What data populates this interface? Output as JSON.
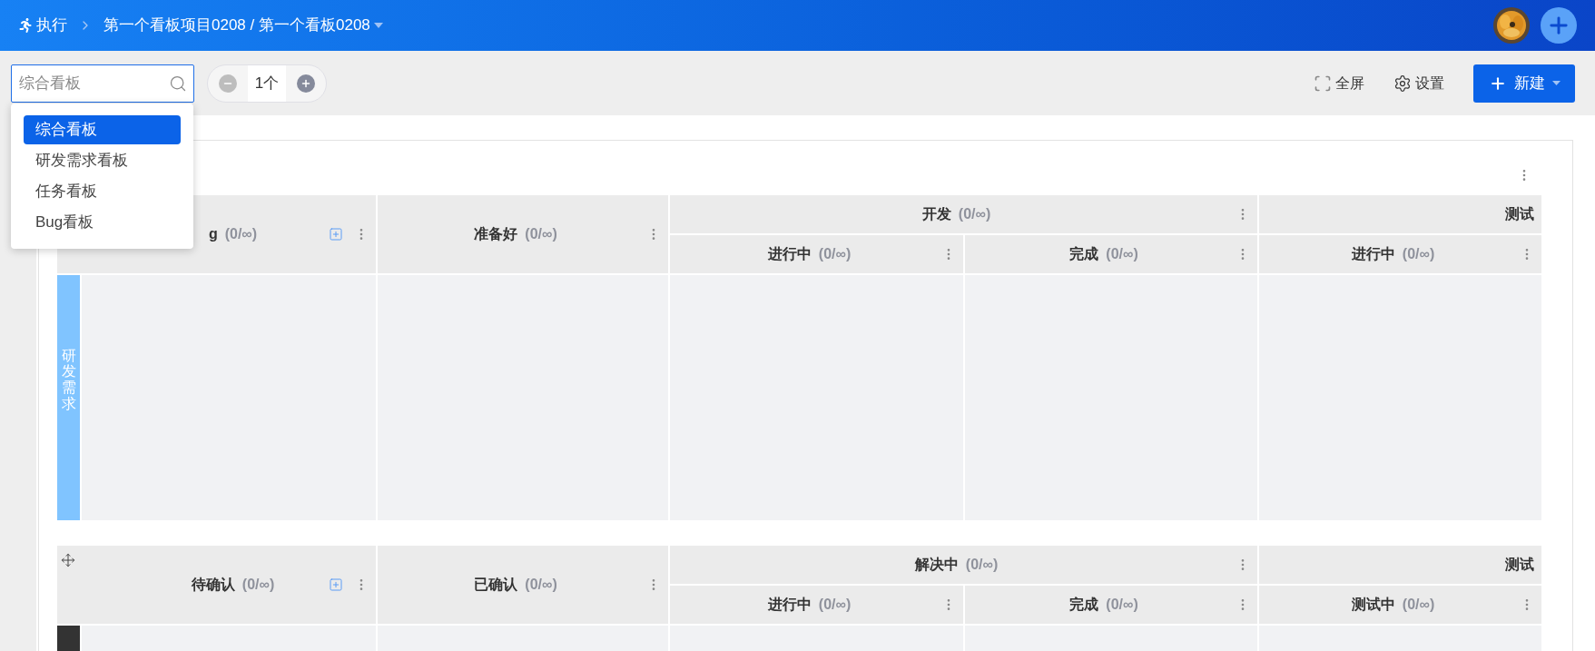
{
  "topbar": {
    "module": "执行",
    "breadcrumb": "第一个看板项目0208 / 第一个看板0208"
  },
  "toolbar": {
    "search": {
      "placeholder": "综合看板"
    },
    "stepper": {
      "value": "1个"
    },
    "actions": [
      {
        "kind": "fullscreen",
        "label": "全屏"
      },
      {
        "kind": "settings",
        "label": "设置"
      }
    ],
    "create_button": "新建"
  },
  "board_menu": [
    {
      "label": "综合看板",
      "selected": true
    },
    {
      "label": "研发需求看板",
      "selected": false
    },
    {
      "label": "任务看板",
      "selected": false
    },
    {
      "label": "Bug看板",
      "selected": false
    }
  ],
  "lanes": [
    {
      "label": "研发需求",
      "color": "#80c4ff",
      "movable": false,
      "columns": [
        {
          "title": "g",
          "count": "(0/∞)",
          "addable": true
        },
        {
          "title": "准备好",
          "count": "(0/∞)",
          "addable": false
        },
        {
          "title": "开发",
          "count": "(0/∞)",
          "children": [
            {
              "title": "进行中",
              "count": "(0/∞)"
            },
            {
              "title": "完成",
              "count": "(0/∞)"
            }
          ]
        },
        {
          "title": "测试",
          "children": [
            {
              "title": "进行中",
              "count": "(0/∞)"
            }
          ]
        }
      ]
    },
    {
      "color": "#333333",
      "movable": true,
      "columns": [
        {
          "title": "待确认",
          "count": "(0/∞)",
          "addable": true
        },
        {
          "title": "已确认",
          "count": "(0/∞)",
          "addable": false
        },
        {
          "title": "解决中",
          "count": "(0/∞)",
          "children": [
            {
              "title": "进行中",
              "count": "(0/∞)"
            },
            {
              "title": "完成",
              "count": "(0/∞)"
            }
          ]
        },
        {
          "title": "测试",
          "children": [
            {
              "title": "测试中",
              "count": "(0/∞)"
            }
          ]
        }
      ]
    }
  ]
}
